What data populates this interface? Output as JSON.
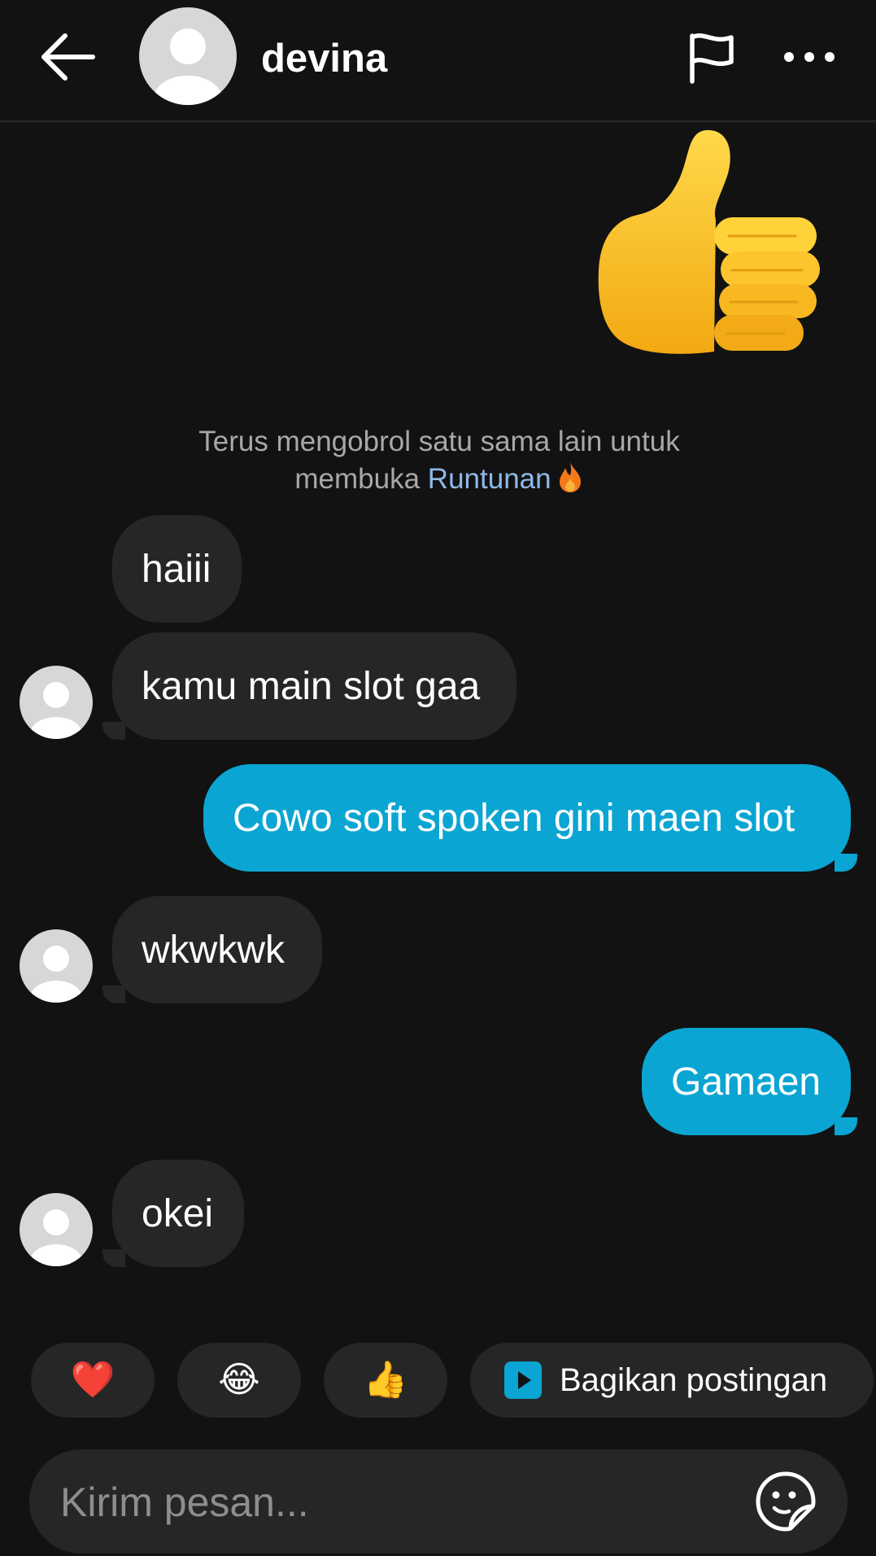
{
  "header": {
    "username": "devina",
    "back_icon": "arrow-left-icon",
    "report_icon": "flag-icon",
    "more_icon": "more-horizontal-icon"
  },
  "sticker": {
    "icon": "thumbs-up-sticker"
  },
  "streak_note": {
    "line1": "Terus mengobrol satu sama lain untuk",
    "line2_prefix": "membuka",
    "link": "Runtunan",
    "icon": "fire-icon"
  },
  "messages": [
    {
      "from": "them",
      "text": "haiii"
    },
    {
      "from": "them",
      "text": "kamu main slot gaa"
    },
    {
      "from": "me",
      "text": "Cowo soft spoken gini maen slot"
    },
    {
      "from": "them",
      "text": "wkwkwk"
    },
    {
      "from": "me",
      "text": "Gamaen"
    },
    {
      "from": "them",
      "text": "okei"
    }
  ],
  "quick_replies": {
    "heart": "❤️",
    "laugh": "😂",
    "thumbs": "👍",
    "share_label": "Bagikan postingan",
    "share_icon": "play-square-icon"
  },
  "composer": {
    "placeholder": "Kirim pesan...",
    "sticker_icon": "sticker-face-icon"
  },
  "colors": {
    "background": "#121212",
    "incoming_bubble": "#262626",
    "outgoing_bubble": "#0aa5d2",
    "link": "#8fb9e8"
  }
}
